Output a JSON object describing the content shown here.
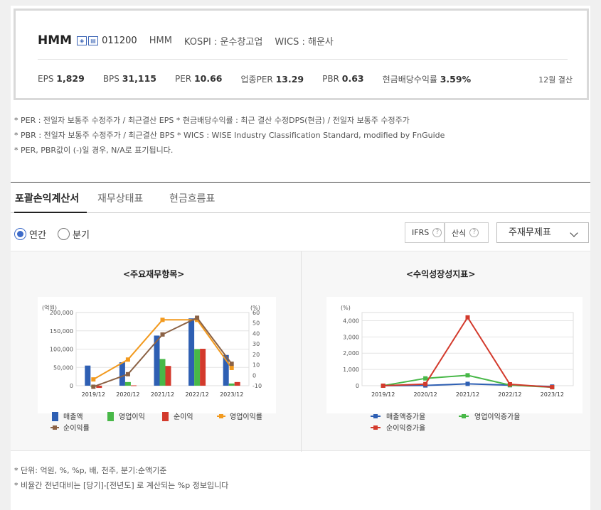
{
  "company": {
    "name": "HMM",
    "icons": [
      "stock-badge-icon",
      "info-badge-icon"
    ],
    "code": "011200",
    "short_name": "HMM",
    "market": "KOSPI : 운수창고업",
    "wics": "WICS : 해운사"
  },
  "metrics": [
    {
      "label": "EPS",
      "value": "1,829"
    },
    {
      "label": "BPS",
      "value": "31,115"
    },
    {
      "label": "PER",
      "value": "10.66"
    },
    {
      "label": "업종PER",
      "value": "13.29"
    },
    {
      "label": "PBR",
      "value": "0.63"
    },
    {
      "label": "현금배당수익률",
      "value": "3.59%"
    }
  ],
  "settlement": "12월 결산",
  "notes": [
    "* PER : 전일자 보통주 수정주가 / 최근결산 EPS * 현금배당수익률 : 최근 결산 수정DPS(현금) / 전일자 보통주 수정주가",
    "* PBR : 전일자 보통주 수정주가 / 최근결산 BPS * WICS : WISE Industry Classification Standard, modified by FnGuide",
    "* PER, PBR값이 (-)일 경우, N/A로 표기됩니다."
  ],
  "tabs": [
    "포괄손익계산서",
    "재무상태표",
    "현금흐름표"
  ],
  "period": {
    "annual": "연간",
    "quarter": "분기"
  },
  "ifrs_label": "IFRS",
  "formula_label": "산식",
  "help_mark": "?",
  "select_value": "주재무제표",
  "chart_data": [
    {
      "type": "bar",
      "title": "<주요재무항목>",
      "ylabel": "(억원)",
      "y2label": "(%)",
      "categories": [
        "2019/12",
        "2020/12",
        "2021/12",
        "2022/12",
        "2023/12"
      ],
      "ylim": [
        0,
        200000
      ],
      "y2lim": [
        -10,
        60
      ],
      "yticks": [
        "0",
        "50,000",
        "100,000",
        "150,000",
        "200,000"
      ],
      "y2ticks": [
        "-10",
        "0",
        "10",
        "20",
        "30",
        "40",
        "50",
        "60"
      ],
      "series": [
        {
          "name": "매출액",
          "kind": "bar",
          "color": "#2e5fb3",
          "values": [
            55000,
            64000,
            137000,
            184000,
            84000
          ]
        },
        {
          "name": "영업이익",
          "kind": "bar",
          "color": "#48b848",
          "values": [
            -3000,
            10000,
            73000,
            100000,
            6000
          ]
        },
        {
          "name": "순이익",
          "kind": "bar",
          "color": "#d33a2c",
          "values": [
            -6000,
            1000,
            54000,
            101000,
            10000
          ]
        },
        {
          "name": "영업이익률",
          "kind": "line",
          "axis": "right",
          "color": "#f29a1f",
          "values": [
            -4,
            15,
            53,
            53,
            7
          ]
        },
        {
          "name": "순이익률",
          "kind": "line",
          "axis": "right",
          "color": "#8b6245",
          "values": [
            -11,
            1,
            39,
            55,
            11
          ]
        }
      ]
    },
    {
      "type": "line",
      "title": "<수익성장성지표>",
      "ylabel": "(%)",
      "categories": [
        "2019/12",
        "2020/12",
        "2021/12",
        "2022/12",
        "2023/12"
      ],
      "ylim": [
        0,
        4500
      ],
      "yticks": [
        "0",
        "1,000",
        "2,000",
        "3,000",
        "4,000"
      ],
      "series": [
        {
          "name": "매출액증가율",
          "color": "#2e5fb3",
          "values": [
            0,
            16,
            114,
            34,
            -54
          ]
        },
        {
          "name": "영업이익증가율",
          "color": "#48b848",
          "values": [
            0,
            450,
            640,
            37,
            -94
          ]
        },
        {
          "name": "순이익증가율",
          "color": "#d33a2c",
          "values": [
            0,
            100,
            4200,
            87,
            -90
          ]
        }
      ]
    }
  ],
  "footnotes": [
    "* 단위: 억원, %, %p, 배, 천주, 분기:순액기준",
    "* 비율간 전년대비는 [당기]-[전년도] 로 계산되는 %p 정보입니다"
  ]
}
